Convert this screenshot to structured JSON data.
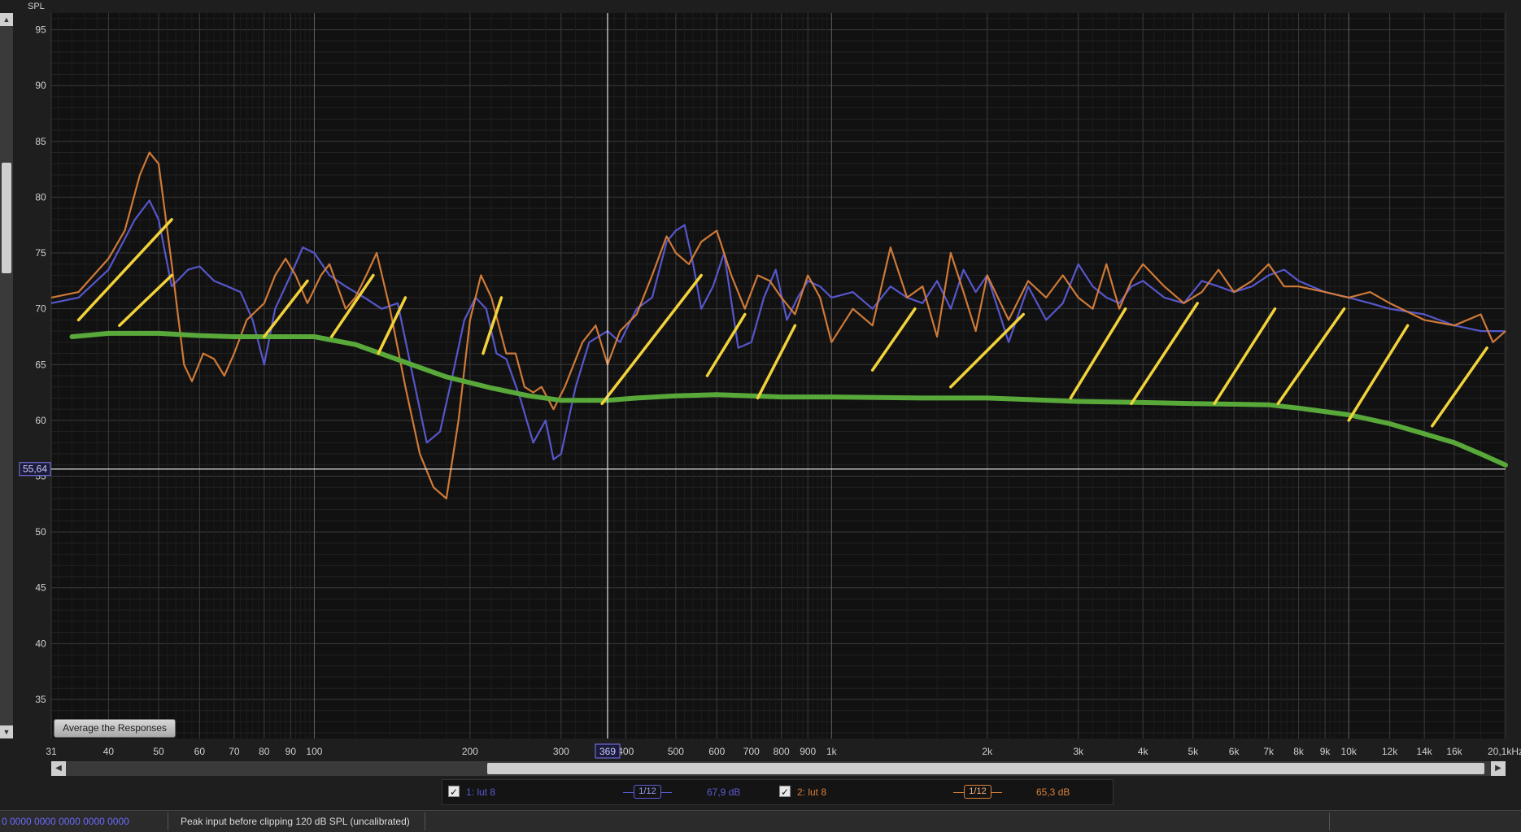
{
  "chart_data": {
    "type": "line",
    "ylabel": "SPL",
    "xscale": "log",
    "xlim": [
      31,
      20100
    ],
    "ylim": [
      31.5,
      96.5
    ],
    "y_ticks": [
      35,
      40,
      45,
      50,
      55,
      60,
      65,
      70,
      75,
      80,
      85,
      90,
      95
    ],
    "x_ticks": [
      {
        "value": 31,
        "label": "31"
      },
      {
        "value": 40,
        "label": "40"
      },
      {
        "value": 50,
        "label": "50"
      },
      {
        "value": 60,
        "label": "60"
      },
      {
        "value": 70,
        "label": "70"
      },
      {
        "value": 80,
        "label": "80"
      },
      {
        "value": 90,
        "label": "90"
      },
      {
        "value": 100,
        "label": "100"
      },
      {
        "value": 200,
        "label": "200"
      },
      {
        "value": 300,
        "label": "300"
      },
      {
        "value": 400,
        "label": "400"
      },
      {
        "value": 500,
        "label": "500"
      },
      {
        "value": 600,
        "label": "600"
      },
      {
        "value": 700,
        "label": "700"
      },
      {
        "value": 800,
        "label": "800"
      },
      {
        "value": 900,
        "label": "900"
      },
      {
        "value": 1000,
        "label": "1k"
      },
      {
        "value": 2000,
        "label": "2k"
      },
      {
        "value": 3000,
        "label": "3k"
      },
      {
        "value": 4000,
        "label": "4k"
      },
      {
        "value": 5000,
        "label": "5k"
      },
      {
        "value": 6000,
        "label": "6k"
      },
      {
        "value": 7000,
        "label": "7k"
      },
      {
        "value": 8000,
        "label": "8k"
      },
      {
        "value": 9000,
        "label": "9k"
      },
      {
        "value": 10000,
        "label": "10k"
      },
      {
        "value": 12000,
        "label": "12k"
      },
      {
        "value": 14000,
        "label": "14k"
      },
      {
        "value": 16000,
        "label": "16k"
      },
      {
        "value": 20100,
        "label": "20,1kHz"
      }
    ],
    "grid": true,
    "cursor": {
      "x": 369,
      "x_label": "369",
      "y": 55.64,
      "y_label": "55,64"
    },
    "series": [
      {
        "name": "1: lut 8",
        "color": "#5b5bd6",
        "points": [
          [
            31,
            70.5
          ],
          [
            35,
            71
          ],
          [
            40,
            73.5
          ],
          [
            45,
            78
          ],
          [
            48,
            79.7
          ],
          [
            50,
            78
          ],
          [
            53,
            72
          ],
          [
            57,
            73.5
          ],
          [
            60,
            73.8
          ],
          [
            64,
            72.5
          ],
          [
            68,
            72
          ],
          [
            72,
            71.5
          ],
          [
            76,
            69
          ],
          [
            80,
            65
          ],
          [
            84,
            70
          ],
          [
            90,
            73
          ],
          [
            95,
            75.5
          ],
          [
            100,
            75
          ],
          [
            107,
            73
          ],
          [
            115,
            72
          ],
          [
            125,
            71
          ],
          [
            135,
            70
          ],
          [
            145,
            70.5
          ],
          [
            155,
            64
          ],
          [
            165,
            58
          ],
          [
            175,
            59
          ],
          [
            185,
            64
          ],
          [
            195,
            69
          ],
          [
            205,
            71
          ],
          [
            215,
            70
          ],
          [
            225,
            66
          ],
          [
            235,
            65.5
          ],
          [
            250,
            62
          ],
          [
            265,
            58
          ],
          [
            280,
            60
          ],
          [
            290,
            56.5
          ],
          [
            300,
            57
          ],
          [
            320,
            63
          ],
          [
            340,
            67
          ],
          [
            369,
            68
          ],
          [
            390,
            67
          ],
          [
            420,
            70
          ],
          [
            450,
            71
          ],
          [
            480,
            76
          ],
          [
            500,
            77
          ],
          [
            520,
            77.5
          ],
          [
            540,
            74
          ],
          [
            560,
            70
          ],
          [
            590,
            72
          ],
          [
            620,
            75
          ],
          [
            660,
            66.5
          ],
          [
            700,
            67
          ],
          [
            740,
            71
          ],
          [
            780,
            73.5
          ],
          [
            820,
            69
          ],
          [
            860,
            71
          ],
          [
            900,
            72.5
          ],
          [
            950,
            72
          ],
          [
            1000,
            71
          ],
          [
            1100,
            71.5
          ],
          [
            1200,
            70
          ],
          [
            1300,
            72
          ],
          [
            1400,
            71
          ],
          [
            1500,
            70.5
          ],
          [
            1600,
            72.5
          ],
          [
            1700,
            70
          ],
          [
            1800,
            73.5
          ],
          [
            1900,
            71.5
          ],
          [
            2000,
            73
          ],
          [
            2200,
            67
          ],
          [
            2400,
            72
          ],
          [
            2600,
            69
          ],
          [
            2800,
            70.5
          ],
          [
            3000,
            74
          ],
          [
            3200,
            72
          ],
          [
            3400,
            71
          ],
          [
            3600,
            70.5
          ],
          [
            3800,
            72
          ],
          [
            4000,
            72.5
          ],
          [
            4400,
            71
          ],
          [
            4800,
            70.5
          ],
          [
            5200,
            72.5
          ],
          [
            5600,
            72
          ],
          [
            6000,
            71.5
          ],
          [
            6500,
            72
          ],
          [
            7000,
            73
          ],
          [
            7500,
            73.5
          ],
          [
            8000,
            72.5
          ],
          [
            9000,
            71.5
          ],
          [
            10000,
            71
          ],
          [
            11000,
            70.5
          ],
          [
            12000,
            70
          ],
          [
            14000,
            69.5
          ],
          [
            16000,
            68.5
          ],
          [
            18000,
            68
          ],
          [
            20100,
            68
          ]
        ]
      },
      {
        "name": "2: lut 8",
        "color": "#d9803a",
        "points": [
          [
            31,
            71
          ],
          [
            35,
            71.5
          ],
          [
            40,
            74.5
          ],
          [
            43,
            77
          ],
          [
            46,
            82
          ],
          [
            48,
            84
          ],
          [
            50,
            83
          ],
          [
            53,
            74
          ],
          [
            56,
            65
          ],
          [
            58,
            63.5
          ],
          [
            61,
            66
          ],
          [
            64,
            65.5
          ],
          [
            67,
            64
          ],
          [
            70,
            66
          ],
          [
            74,
            69
          ],
          [
            80,
            70.5
          ],
          [
            84,
            73
          ],
          [
            88,
            74.5
          ],
          [
            92,
            73
          ],
          [
            97,
            70.5
          ],
          [
            103,
            73
          ],
          [
            107,
            74
          ],
          [
            115,
            70
          ],
          [
            120,
            71
          ],
          [
            126,
            73
          ],
          [
            132,
            75
          ],
          [
            140,
            70
          ],
          [
            150,
            63
          ],
          [
            160,
            57
          ],
          [
            170,
            54
          ],
          [
            180,
            53
          ],
          [
            190,
            60
          ],
          [
            200,
            69
          ],
          [
            210,
            73
          ],
          [
            220,
            71
          ],
          [
            235,
            66
          ],
          [
            245,
            66
          ],
          [
            255,
            63
          ],
          [
            265,
            62.5
          ],
          [
            275,
            63
          ],
          [
            290,
            61
          ],
          [
            305,
            63
          ],
          [
            330,
            67
          ],
          [
            350,
            68.5
          ],
          [
            369,
            65
          ],
          [
            390,
            68
          ],
          [
            420,
            69.5
          ],
          [
            450,
            73
          ],
          [
            480,
            76.5
          ],
          [
            500,
            75
          ],
          [
            530,
            74
          ],
          [
            560,
            76
          ],
          [
            600,
            77
          ],
          [
            640,
            73
          ],
          [
            680,
            70
          ],
          [
            720,
            73
          ],
          [
            760,
            72.5
          ],
          [
            800,
            71
          ],
          [
            850,
            69.5
          ],
          [
            900,
            73
          ],
          [
            950,
            71
          ],
          [
            1000,
            67
          ],
          [
            1100,
            70
          ],
          [
            1200,
            68.5
          ],
          [
            1300,
            75.5
          ],
          [
            1400,
            71
          ],
          [
            1500,
            72
          ],
          [
            1600,
            67.5
          ],
          [
            1700,
            75
          ],
          [
            1800,
            71.5
          ],
          [
            1900,
            68
          ],
          [
            2000,
            73
          ],
          [
            2200,
            69
          ],
          [
            2400,
            72.5
          ],
          [
            2600,
            71
          ],
          [
            2800,
            73
          ],
          [
            3000,
            71
          ],
          [
            3200,
            70
          ],
          [
            3400,
            74
          ],
          [
            3600,
            70
          ],
          [
            3800,
            72.5
          ],
          [
            4000,
            74
          ],
          [
            4400,
            72
          ],
          [
            4800,
            70.5
          ],
          [
            5200,
            71.5
          ],
          [
            5600,
            73.5
          ],
          [
            6000,
            71.5
          ],
          [
            6500,
            72.5
          ],
          [
            7000,
            74
          ],
          [
            7500,
            72
          ],
          [
            8000,
            72
          ],
          [
            9000,
            71.5
          ],
          [
            10000,
            71
          ],
          [
            11000,
            71.5
          ],
          [
            12000,
            70.5
          ],
          [
            14000,
            69
          ],
          [
            16000,
            68.5
          ],
          [
            18000,
            69.5
          ],
          [
            19000,
            67
          ],
          [
            20100,
            68
          ]
        ]
      }
    ],
    "annotations": {
      "target_curve": {
        "color": "#58a83a",
        "points": [
          [
            34,
            67.5
          ],
          [
            40,
            67.8
          ],
          [
            50,
            67.8
          ],
          [
            60,
            67.6
          ],
          [
            70,
            67.5
          ],
          [
            80,
            67.5
          ],
          [
            100,
            67.5
          ],
          [
            120,
            66.8
          ],
          [
            150,
            65.2
          ],
          [
            180,
            63.9
          ],
          [
            220,
            62.9
          ],
          [
            260,
            62.2
          ],
          [
            300,
            61.8
          ],
          [
            369,
            61.8
          ],
          [
            420,
            62
          ],
          [
            500,
            62.2
          ],
          [
            600,
            62.3
          ],
          [
            700,
            62.2
          ],
          [
            800,
            62.1
          ],
          [
            1000,
            62.1
          ],
          [
            1500,
            62
          ],
          [
            2000,
            62
          ],
          [
            3000,
            61.7
          ],
          [
            4000,
            61.6
          ],
          [
            5000,
            61.5
          ],
          [
            7000,
            61.4
          ],
          [
            8000,
            61.1
          ],
          [
            10000,
            60.5
          ],
          [
            12000,
            59.7
          ],
          [
            14000,
            58.8
          ],
          [
            16000,
            58
          ],
          [
            18000,
            57
          ],
          [
            20100,
            56
          ]
        ]
      },
      "hatch_strokes": {
        "color": "#f2d23a",
        "lines": [
          [
            [
              35,
              69
            ],
            [
              53,
              78
            ]
          ],
          [
            [
              42,
              68.5
            ],
            [
              53,
              73
            ]
          ],
          [
            [
              80,
              67.5
            ],
            [
              97,
              72.5
            ]
          ],
          [
            [
              108,
              67.5
            ],
            [
              130,
              73
            ]
          ],
          [
            [
              133,
              66
            ],
            [
              150,
              71
            ]
          ],
          [
            [
              212,
              66
            ],
            [
              230,
              71
            ]
          ],
          [
            [
              360,
              61.5
            ],
            [
              560,
              73
            ]
          ],
          [
            [
              575,
              64
            ],
            [
              680,
              69.5
            ]
          ],
          [
            [
              720,
              62
            ],
            [
              850,
              68.5
            ]
          ],
          [
            [
              1200,
              64.5
            ],
            [
              1450,
              70
            ]
          ],
          [
            [
              1700,
              63
            ],
            [
              2350,
              69.5
            ]
          ],
          [
            [
              2900,
              62
            ],
            [
              3700,
              70
            ]
          ],
          [
            [
              3800,
              61.5
            ],
            [
              5100,
              70.5
            ]
          ],
          [
            [
              5500,
              61.5
            ],
            [
              7200,
              70
            ]
          ],
          [
            [
              7300,
              61.5
            ],
            [
              9800,
              70
            ]
          ],
          [
            [
              10000,
              60
            ],
            [
              13000,
              68.5
            ]
          ],
          [
            [
              14500,
              59.5
            ],
            [
              18500,
              66.5
            ]
          ]
        ]
      }
    }
  },
  "ui": {
    "average_button_label": "Average the Responses",
    "hscroll": {
      "left_arrow": "◀",
      "right_arrow": "▶"
    },
    "vscroll": {
      "up_arrow": "▲",
      "down_arrow": "▼"
    },
    "legend": {
      "items": [
        {
          "checkbox": "✓",
          "label": "1: lut 8",
          "smoothing": "1/12",
          "level": "67,9 dB",
          "color": "#5b5bd6"
        },
        {
          "checkbox": "✓",
          "label": "2: lut 8",
          "smoothing": "1/12",
          "level": "65,3 dB",
          "color": "#d9803a"
        }
      ]
    },
    "status": {
      "counters": "0 0000  0000 0000  0000 0000",
      "message": "Peak input before clipping 120 dB SPL (uncalibrated)"
    }
  }
}
